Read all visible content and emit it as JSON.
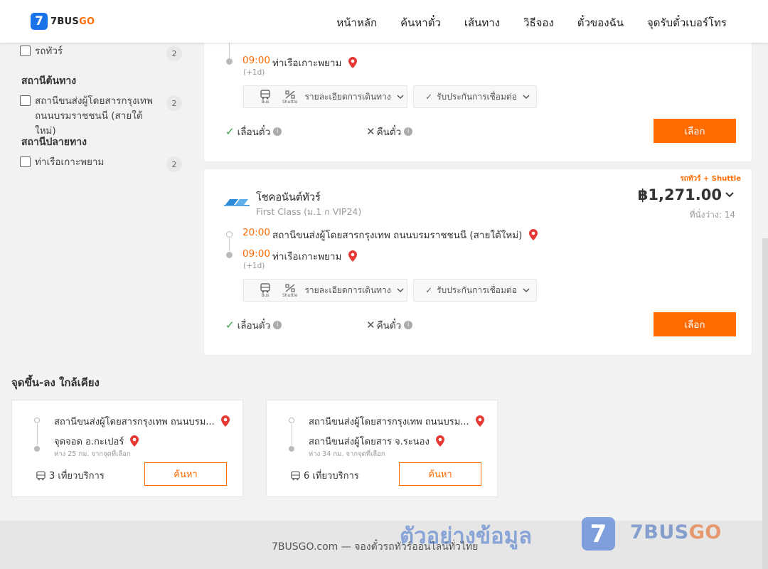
{
  "header": {
    "logo_mark": "7",
    "logo_text_a": "7BUS",
    "logo_text_b": "GO",
    "nav": [
      "หน้าหลัก",
      "ค้นหาตั๋ว",
      "เส้นทาง",
      "วิธีจอง",
      "ตั๋วของฉัน",
      "จุดรับตั๋วเบอร์โทร"
    ]
  },
  "sidebar": {
    "vehicle_item": {
      "label": "รถทัวร์",
      "count": "2"
    },
    "origin_title": "สถานีต้นทาง",
    "origin_item": {
      "label": "สถานีขนส่งผู้โดยสารกรุงเทพ ถนนบรมราชชนนี (สายใต้ใหม่)",
      "count": "2"
    },
    "dest_title": "สถานีปลายทาง",
    "dest_item": {
      "label": "ท่าเรือเกาะพยาม",
      "count": "2"
    }
  },
  "card1": {
    "arrive_time": "09:00",
    "arrive_station": "ท่าเรือเกาะพยาม",
    "nextday": "(+1d)",
    "details_label": "รายละเอียดการเดินทาง",
    "bus_label": "Bus",
    "shuttle_label": "Shuttle",
    "insurance_label": "รับประกันการเชื่อมต่อ",
    "reschedule": "เลื่อนตั๋ว",
    "refund": "คืนตั๋ว",
    "select": "เลือก"
  },
  "card2": {
    "badge": "รถทัวร์ + Shuttle",
    "operator": "โชคอนันต์ทัวร์",
    "class": "First Class (ม.1 ก VIP24)",
    "price": "฿1,271.00",
    "seats": "ที่นั่งว่าง: 14",
    "depart_time": "20:00",
    "depart_station": "สถานีขนส่งผู้โดยสารกรุงเทพ ถนนบรมราชชนนี (สายใต้ใหม่)",
    "arrive_time": "09:00",
    "arrive_station": "ท่าเรือเกาะพยาม",
    "nextday": "(+1d)",
    "details_label": "รายละเอียดการเดินทาง",
    "bus_label": "Bus",
    "shuttle_label": "Shuttle",
    "insurance_label": "รับประกันการเชื่อมต่อ",
    "reschedule": "เลื่อนตั๋ว",
    "refund": "คืนตั๋ว",
    "select": "เลือก"
  },
  "nearby": {
    "title": "จุดขึ้น-ลง ใกล้เคียง",
    "cards": [
      {
        "from": "สถานีขนส่งผู้โดยสารกรุงเทพ ถนนบรม...",
        "to": "จุดจอด อ.กะเปอร์",
        "distance": "ห่าง 25 กม. จากจุดที่เลือก",
        "trips": "3 เที่ยวบริการ",
        "button": "ค้นหา"
      },
      {
        "from": "สถานีขนส่งผู้โดยสารกรุงเทพ ถนนบรม...",
        "to": "สถานีขนส่งผู้โดยสาร จ.ระนอง",
        "distance": "ห่าง 34 กม. จากจุดที่เลือก",
        "trips": "6 เที่ยวบริการ",
        "button": "ค้นหา"
      }
    ]
  },
  "footer": {
    "text": "7BUSGO.com — จองตั๋วรถทัวร์ออนไลน์ทั่วไทย",
    "watermark": "ตัวอย่างข้อมูล",
    "wm_logo": "7",
    "wm_brand_a": "7BUS",
    "wm_brand_b": "GO"
  },
  "colors": {
    "accent": "#ff6b00",
    "brand_blue": "#1a73e8",
    "check_green": "#2e9a3a"
  }
}
